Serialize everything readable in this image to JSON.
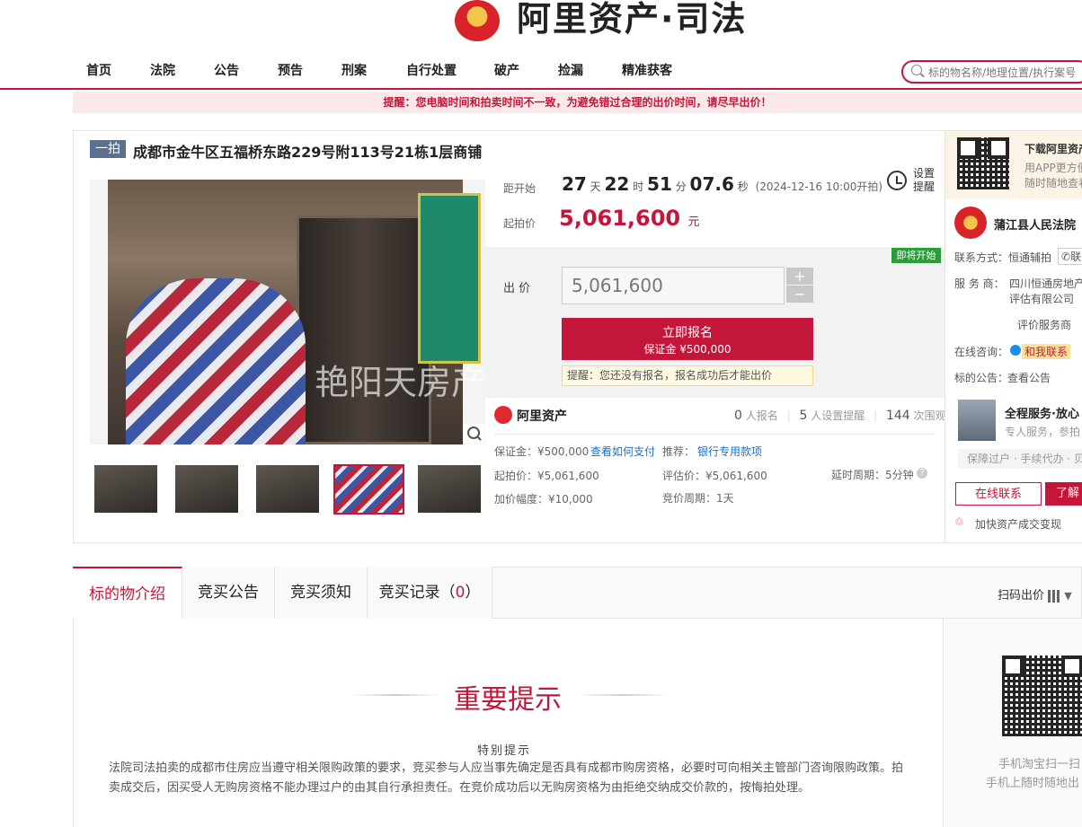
{
  "header": {
    "brand": "阿里资产·司法",
    "nav": [
      "首页",
      "法院",
      "公告",
      "预告",
      "刑案",
      "自行处置",
      "破产",
      "捡漏",
      "精准获客"
    ],
    "search_placeholder": "标的物名称/地理位置/执行案号"
  },
  "notice": "提醒：您电脑时间和拍卖时间不一致，为避免错过合理的出价时间，请尽早出价！",
  "item": {
    "badge": "一拍",
    "title": "成都市金牛区五福桥东路229号附113号21栋1层商铺",
    "watermark": "艳阳天房产",
    "thumbnails": 5,
    "selected_thumbnail": 4
  },
  "countdown": {
    "label": "距开始",
    "days": "27",
    "d_unit": "天",
    "hours": "22",
    "h_unit": "时",
    "minutes": "51",
    "m_unit": "分",
    "seconds": "07.6",
    "s_unit": "秒",
    "start_time": "(2024-12-16 10:00开拍)"
  },
  "remind": {
    "line1": "设置",
    "line2": "提醒"
  },
  "start_price": {
    "label": "起拍价",
    "value": "5,061,600",
    "unit": "元"
  },
  "bid": {
    "label": "出 价",
    "value": "5,061,600",
    "plus": "+",
    "minus": "−",
    "soon_badge": "即将开始",
    "signup_label": "立即报名",
    "deposit_line": "保证金 ¥500,000",
    "tip": "提醒：您还没有报名，报名成功后才能出价"
  },
  "platform": {
    "name": "阿里资产",
    "signups": "0",
    "signups_label": "人报名",
    "reminders": "5",
    "reminders_label": "人设置提醒",
    "views": "144",
    "views_label": "次围观"
  },
  "details": {
    "deposit": "保证金：¥500,000",
    "how_to_pay": "查看如何支付",
    "recommend_label": "推荐：",
    "recommend_link": "银行专用款项",
    "start_price": "起拍价：¥5,061,600",
    "appraisal": "评估价：¥5,061,600",
    "delay": "延时周期：5分钟",
    "increment": "加价幅度：¥10,000",
    "cycle": "竞价周期：1天"
  },
  "right": {
    "app_title": "下载阿里资产",
    "app_line1": "用APP更方便",
    "app_line2": "随时随地查看",
    "court": "蒲江县人民法院",
    "contact_label": "联系方式：",
    "contact_value": "恒通辅拍",
    "contact_btn": "联",
    "service_label": "服 务 商：",
    "service_value1": "四川恒通房地产",
    "service_value2": "评估有限公司",
    "rate_link": "评价服务商",
    "consult_label": "在线咨询：",
    "consult_btn": "和我联系",
    "announce_label": "标的公告：",
    "announce_link": "查看公告",
    "service_title": "全程服务·放心",
    "service_sub": "专人服务，参拍",
    "service_tags": "保障过户 · 手续代办 · 贝",
    "btn_online": "在线联系",
    "btn_more": "了解",
    "accelerate": "加快资产成交变现"
  },
  "tabs": {
    "items": [
      "标的物介绍",
      "竞买公告",
      "竞买须知",
      "竞买记录（"
    ],
    "record_count": "0",
    "record_close": "）",
    "scan_bid": "扫码出价"
  },
  "content": {
    "heading": "重要提示",
    "subheading": "特别提示",
    "paragraph": "法院司法拍卖的成都市住房应当遵守相关限购政策的要求，竞买参与人应当事先确定是否具有成都市购房资格，必要时可向相关主管部门咨询限购政策。拍卖成交后，因买受人无购房资格不能办理过户的由其自行承担责任。在竞价成功后以无购房资格为由拒绝交纳成交价款的，按悔拍处理。",
    "right_line1": "手机淘宝扫一扫",
    "right_line2": "手机上随时随地出"
  }
}
